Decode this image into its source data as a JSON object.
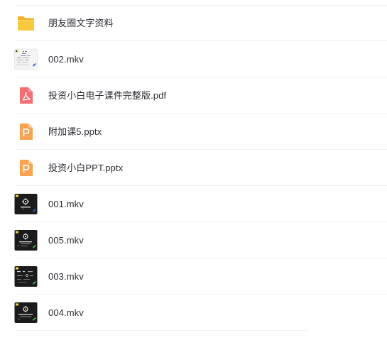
{
  "files": [
    {
      "name": "朋友圈文字资料",
      "type": "folder",
      "icon": "folder-icon",
      "color": "#f7c23b"
    },
    {
      "name": "002.mkv",
      "type": "video",
      "icon": "video-thumbnail-light",
      "color": "#f4f4f4"
    },
    {
      "name": "投资小白电子课件完整版.pdf",
      "type": "pdf",
      "icon": "pdf-icon",
      "color": "#f2636b"
    },
    {
      "name": "附加课5.pptx",
      "type": "ppt",
      "icon": "ppt-icon",
      "color": "#f8a150"
    },
    {
      "name": "投资小白PPT.pptx",
      "type": "ppt",
      "icon": "ppt-icon",
      "color": "#f8a150"
    },
    {
      "name": "001.mkv",
      "type": "video",
      "icon": "video-thumbnail-dark",
      "color": "#1c1c1c"
    },
    {
      "name": "005.mkv",
      "type": "video",
      "icon": "video-thumbnail-dark",
      "color": "#1c1c1c"
    },
    {
      "name": "003.mkv",
      "type": "video",
      "icon": "video-thumbnail-dark",
      "color": "#1c1c1c"
    },
    {
      "name": "004.mkv",
      "type": "video",
      "icon": "video-thumbnail-dark",
      "color": "#1c1c1c"
    }
  ]
}
